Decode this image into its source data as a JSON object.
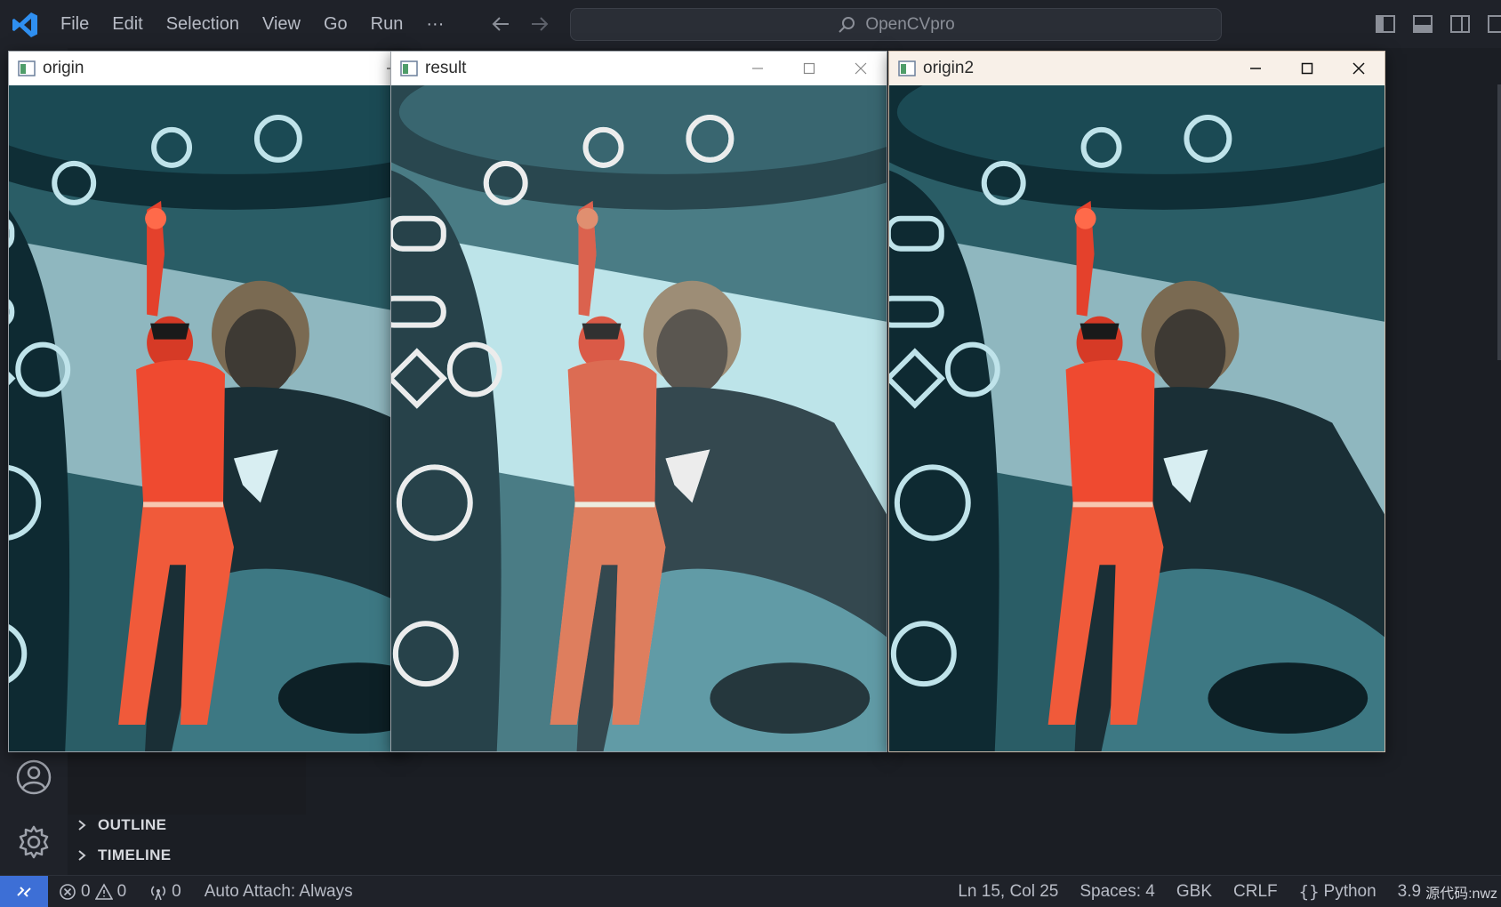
{
  "menu": [
    "File",
    "Edit",
    "Selection",
    "View",
    "Go",
    "Run",
    "···"
  ],
  "command_center": {
    "label": "OpenCVpro"
  },
  "windows": [
    {
      "title": "origin",
      "variant": "original"
    },
    {
      "title": "result",
      "variant": "brightened"
    },
    {
      "title": "origin2",
      "variant": "original"
    }
  ],
  "sidebar_sections": [
    {
      "label": "OUTLINE"
    },
    {
      "label": "TIMELINE"
    }
  ],
  "statusbar": {
    "errors": "0",
    "warnings": "0",
    "ports": "0",
    "auto_attach": "Auto Attach: Always",
    "position": "Ln 15, Col 25",
    "spaces": "Spaces: 4",
    "encoding": "GBK",
    "eol": "CRLF",
    "language": "Python",
    "version": "3.9"
  },
  "watermark": "源代码:nwz",
  "colors": {
    "accent": "#3d6fd6",
    "titlebar": "#1f2229",
    "active_window_title": "#f8f0e8"
  }
}
